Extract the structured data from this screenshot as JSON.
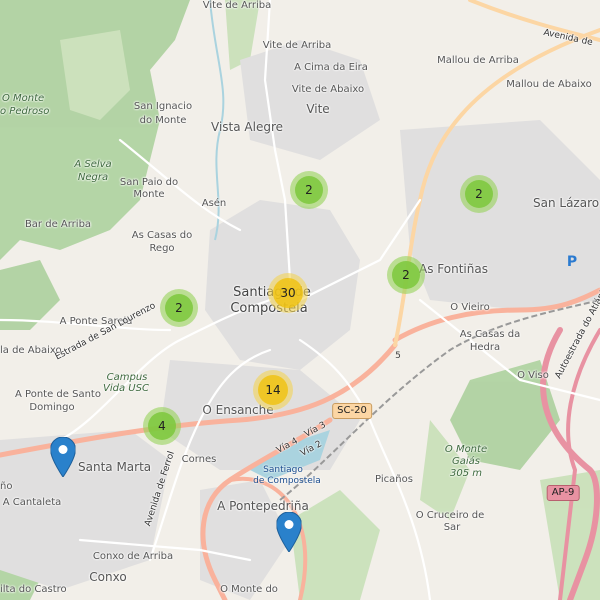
{
  "colors": {
    "land": "#f2efe9",
    "forest": "#add19e",
    "residential": "#e0dfdf",
    "motorway": "#e892a2",
    "trunk": "#f9b29c",
    "primary": "#fcd6a4",
    "water": "#aad3df",
    "cluster_small": "#7dc83c",
    "cluster_medium": "#f0c20c",
    "pin": "#2a81cb"
  },
  "place_labels": [
    {
      "id": "vite-de-arriba-top",
      "text": "Vite de Arriba"
    },
    {
      "id": "vite-de-arriba",
      "text": "Vite de Arriba"
    },
    {
      "id": "a-cima-da-eira",
      "text": "A Cima da Eira"
    },
    {
      "id": "vite-de-abaixo",
      "text": "Vite de Abaixo"
    },
    {
      "id": "vite",
      "text": "Vite"
    },
    {
      "id": "mallou-de-arriba",
      "text": "Mallou de Arriba"
    },
    {
      "id": "mallou-de-abaixo",
      "text": "Mallou de Abaixo"
    },
    {
      "id": "o-monte-1",
      "text": "O Monte"
    },
    {
      "id": "o-monte-2",
      "text": "o Pedroso"
    },
    {
      "id": "san-ignacio-1",
      "text": "San Ignacio"
    },
    {
      "id": "san-ignacio-2",
      "text": "do Monte"
    },
    {
      "id": "vista-alegre",
      "text": "Vista Alegre"
    },
    {
      "id": "a-selva-1",
      "text": "A Selva"
    },
    {
      "id": "a-selva-2",
      "text": "Negra"
    },
    {
      "id": "san-paio-1",
      "text": "San Paio do"
    },
    {
      "id": "san-paio-2",
      "text": "Monte"
    },
    {
      "id": "asen",
      "text": "Asén"
    },
    {
      "id": "san-lazaro",
      "text": "San Lázaro"
    },
    {
      "id": "bar-de-arriba",
      "text": "Bar de Arriba"
    },
    {
      "id": "as-casas-do-rego-1",
      "text": "As Casas do"
    },
    {
      "id": "as-casas-do-rego-2",
      "text": "Rego"
    },
    {
      "id": "santiago-1",
      "text": "Santiago de"
    },
    {
      "id": "santiago-2",
      "text": "Compostela"
    },
    {
      "id": "as-fontinas",
      "text": "As Fontiñas"
    },
    {
      "id": "o-vieiro",
      "text": "O Vieiro"
    },
    {
      "id": "a-ponte-sarela",
      "text": "A Ponte Sarela"
    },
    {
      "id": "as-casas-da-hedra-1",
      "text": "As Casas da"
    },
    {
      "id": "as-casas-da-hedra-2",
      "text": "Hedra"
    },
    {
      "id": "la-de-abaixo",
      "text": "la de Abaixo"
    },
    {
      "id": "o-viso",
      "text": "O Viso"
    },
    {
      "id": "campus-1",
      "text": "Campus"
    },
    {
      "id": "campus-2",
      "text": "Vida USC"
    },
    {
      "id": "a-ponte-de-santo-1",
      "text": "A Ponte de Santo"
    },
    {
      "id": "a-ponte-de-santo-2",
      "text": "Domingo"
    },
    {
      "id": "o-ensanche",
      "text": "O Ensanche"
    },
    {
      "id": "o-monte-gaias-1",
      "text": "O Monte"
    },
    {
      "id": "o-monte-gaias-2",
      "text": "Gaiás"
    },
    {
      "id": "o-monte-gaias-3",
      "text": "305 m"
    },
    {
      "id": "santa-marta",
      "text": "Santa Marta"
    },
    {
      "id": "cornes",
      "text": "Cornes"
    },
    {
      "id": "picanos",
      "text": "Picaños"
    },
    {
      "id": "nho",
      "text": "ño"
    },
    {
      "id": "a-cantaleta",
      "text": "A Cantaleta"
    },
    {
      "id": "a-pontepedrina",
      "text": "A Pontepedriña"
    },
    {
      "id": "o-cruceiro-1",
      "text": "O Cruceiro de"
    },
    {
      "id": "o-cruceiro-2",
      "text": "Sar"
    },
    {
      "id": "conxo-de-arriba",
      "text": "Conxo de Arriba"
    },
    {
      "id": "conxo",
      "text": "Conxo"
    },
    {
      "id": "ilta-do-castro",
      "text": "ilta do Castro"
    },
    {
      "id": "o-monte-do",
      "text": "O Monte do"
    }
  ],
  "road_labels": [
    {
      "id": "avenida-de",
      "text": "Avenida de"
    },
    {
      "id": "estrada-san-lourenzo",
      "text": "Estrada de San Lourenzo"
    },
    {
      "id": "avenida-ferrol",
      "text": "Avenida de Ferrol"
    },
    {
      "id": "via-4",
      "text": "Vía 4"
    },
    {
      "id": "via-3",
      "text": "Vía 3"
    },
    {
      "id": "via-2",
      "text": "Vía 2"
    },
    {
      "id": "autoestrada",
      "text": "Autoestrada do Atlántico"
    }
  ],
  "station_label": [
    "Santiago",
    "de Compostela"
  ],
  "shields": [
    {
      "id": "sc-20",
      "text": "SC-20"
    },
    {
      "id": "ap-9",
      "text": "AP-9"
    },
    {
      "id": "n-5",
      "text": "5"
    }
  ],
  "parking_label": "P",
  "clusters": [
    {
      "id": "cluster-vite",
      "count": "2",
      "size": "small"
    },
    {
      "id": "cluster-san-lazaro",
      "count": "2",
      "size": "small"
    },
    {
      "id": "cluster-fontinas",
      "count": "2",
      "size": "small"
    },
    {
      "id": "cluster-sarela",
      "count": "2",
      "size": "small"
    },
    {
      "id": "cluster-center",
      "count": "30",
      "size": "medium"
    },
    {
      "id": "cluster-ensanche",
      "count": "14",
      "size": "medium"
    },
    {
      "id": "cluster-santa-marta",
      "count": "4",
      "size": "small"
    }
  ],
  "markers": [
    {
      "id": "marker-santa-marta"
    },
    {
      "id": "marker-pontepedrina"
    }
  ]
}
